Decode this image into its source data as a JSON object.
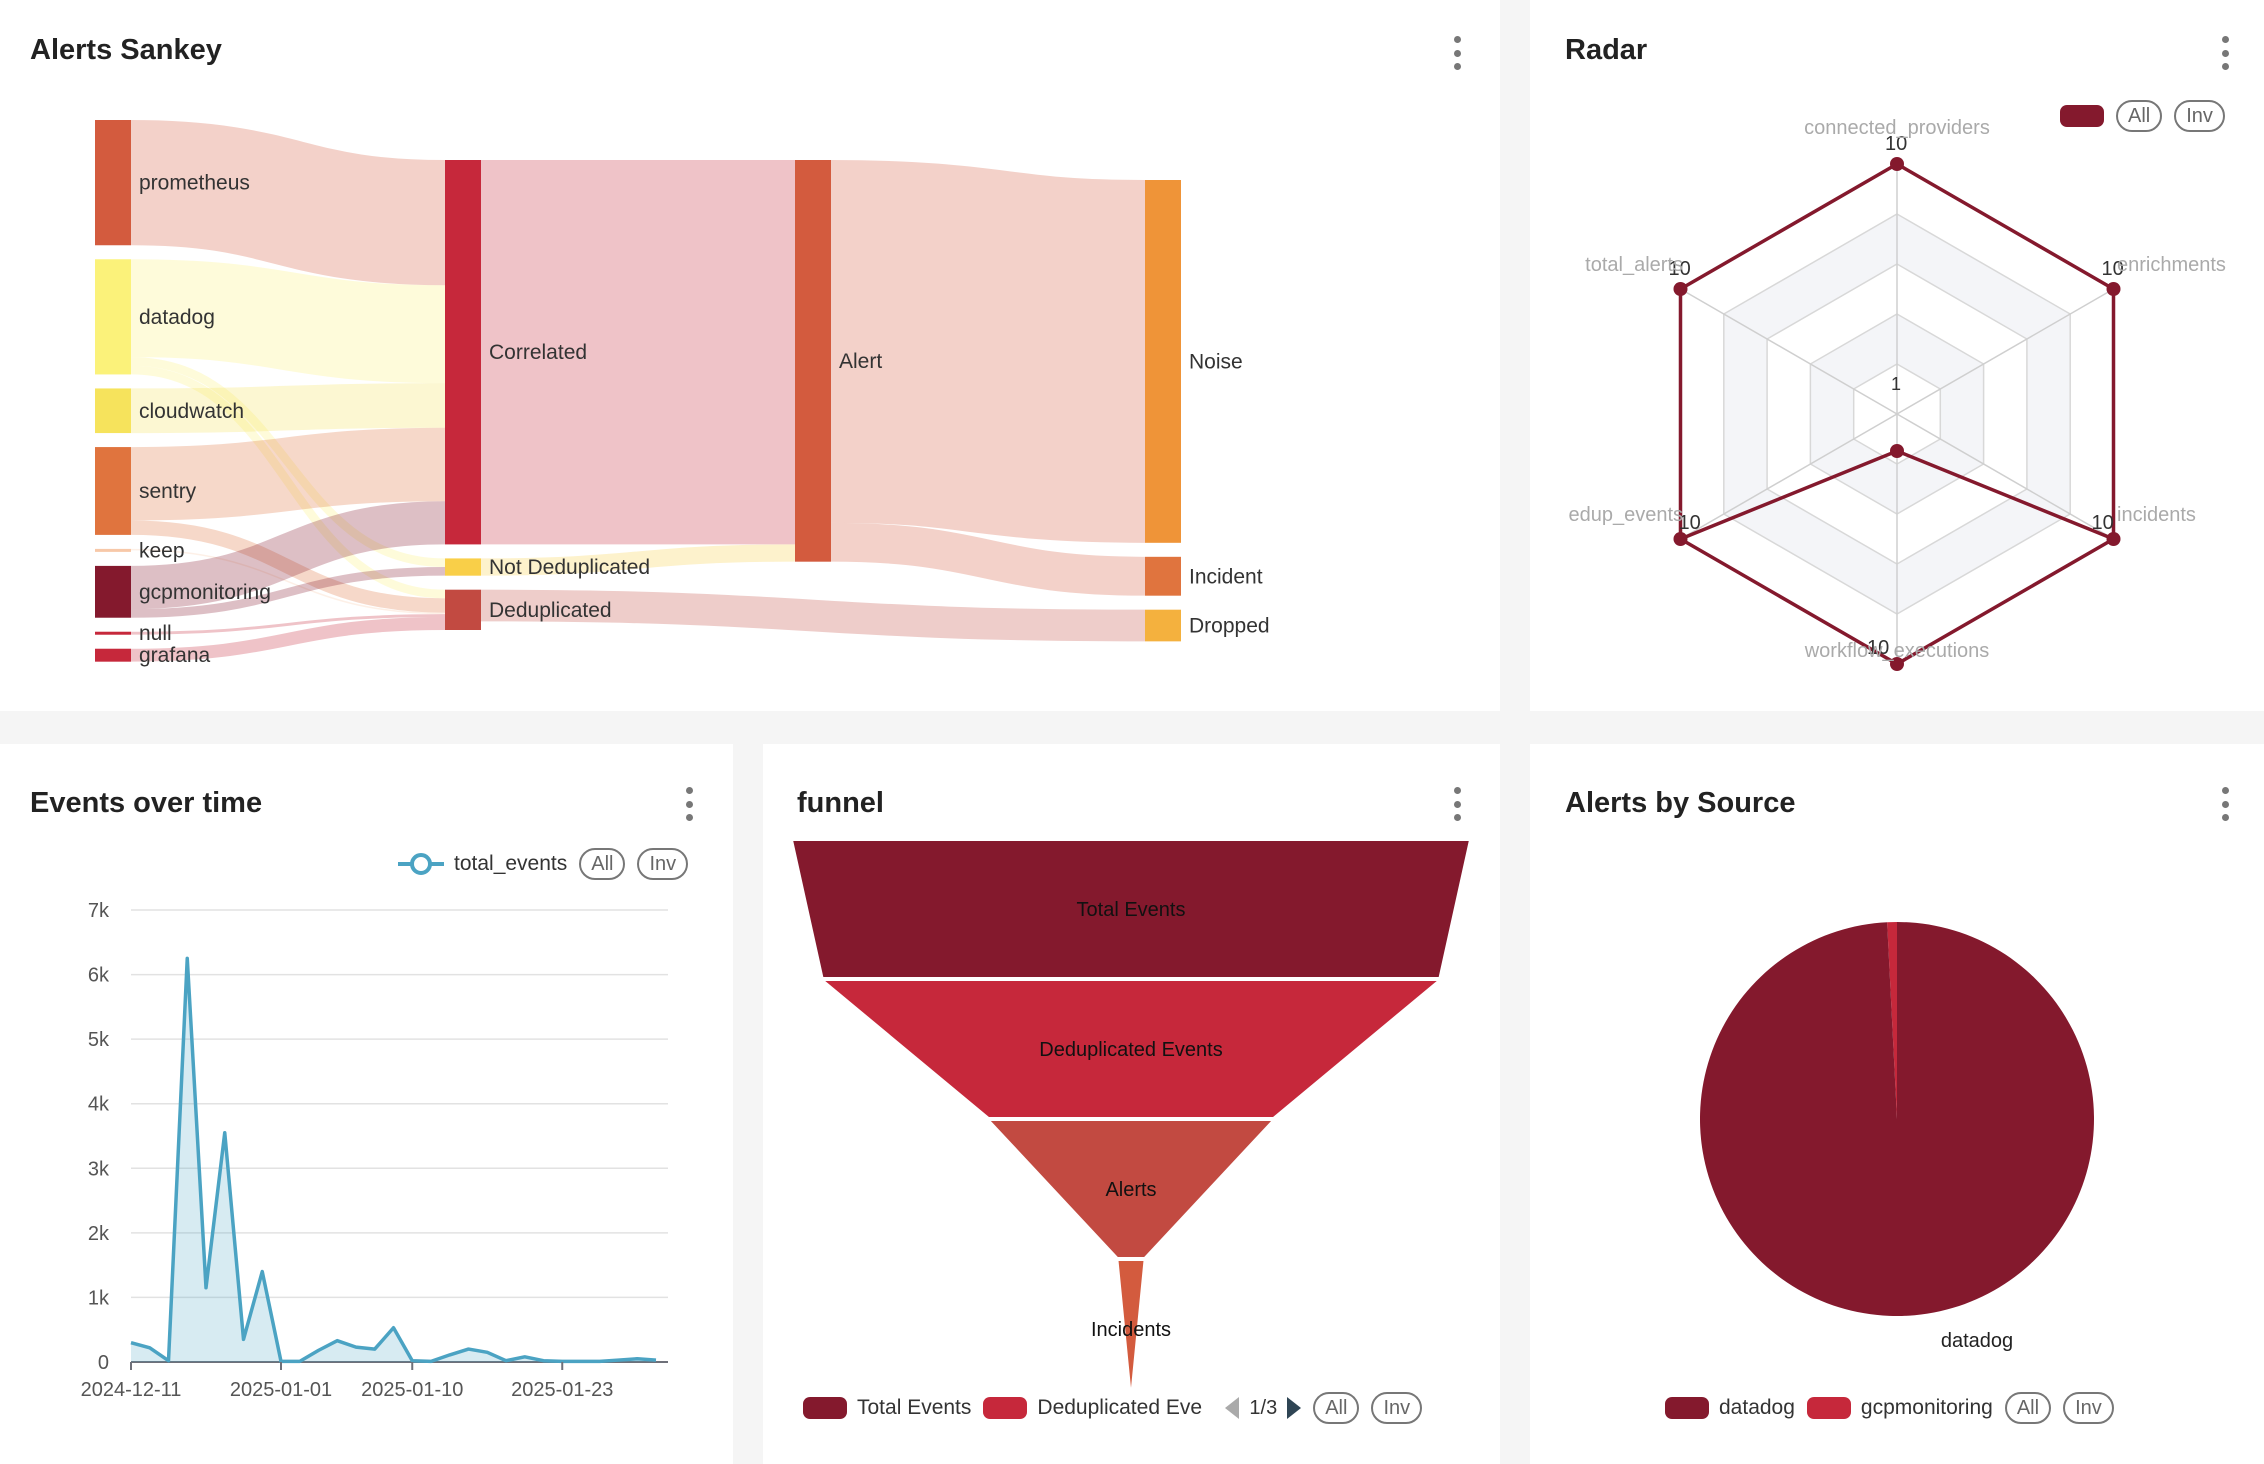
{
  "colors": {
    "maroon": "#84192d",
    "red": "#c6283b",
    "brick": "#c24a41",
    "orange_red": "#d35b3e",
    "orange": "#e0743e",
    "amber": "#ef9438",
    "gold": "#f4b13e",
    "yellow": "#f6e35c",
    "light_yellow": "#fbf27a",
    "line_blue": "#4ba3c3"
  },
  "menu_icon": "kebab-menu-icon",
  "sankey": {
    "title": "Alerts Sankey",
    "chart_data": {
      "type": "sankey",
      "nodes": [
        {
          "name": "prometheus",
          "column": 0
        },
        {
          "name": "datadog",
          "column": 0
        },
        {
          "name": "cloudwatch",
          "column": 0
        },
        {
          "name": "sentry",
          "column": 0
        },
        {
          "name": "keep",
          "column": 0
        },
        {
          "name": "gcpmonitoring",
          "column": 0
        },
        {
          "name": "null",
          "column": 0
        },
        {
          "name": "grafana",
          "column": 0
        },
        {
          "name": "Correlated",
          "column": 1
        },
        {
          "name": "Not Deduplicated",
          "column": 1
        },
        {
          "name": "Deduplicated",
          "column": 1
        },
        {
          "name": "Alert",
          "column": 2
        },
        {
          "name": "Noise",
          "column": 3
        },
        {
          "name": "Incident",
          "column": 3
        },
        {
          "name": "Dropped",
          "column": 3
        }
      ],
      "links": [
        {
          "source": "prometheus",
          "target": "Correlated",
          "value": 87
        },
        {
          "source": "datadog",
          "target": "Correlated",
          "value": 68
        },
        {
          "source": "datadog",
          "target": "Not Deduplicated",
          "value": 6
        },
        {
          "source": "datadog",
          "target": "Deduplicated",
          "value": 6
        },
        {
          "source": "cloudwatch",
          "target": "Correlated",
          "value": 31
        },
        {
          "source": "sentry",
          "target": "Correlated",
          "value": 51
        },
        {
          "source": "sentry",
          "target": "Deduplicated",
          "value": 10
        },
        {
          "source": "keep",
          "target": "Deduplicated",
          "value": 1
        },
        {
          "source": "gcpmonitoring",
          "target": "Correlated",
          "value": 30
        },
        {
          "source": "gcpmonitoring",
          "target": "Not Deduplicated",
          "value": 6
        },
        {
          "source": "null",
          "target": "Deduplicated",
          "value": 2
        },
        {
          "source": "grafana",
          "target": "Deduplicated",
          "value": 9
        },
        {
          "source": "Correlated",
          "target": "Alert",
          "value": 267
        },
        {
          "source": "Not Deduplicated",
          "target": "Alert",
          "value": 12
        },
        {
          "source": "Deduplicated",
          "target": "Dropped",
          "value": 22
        },
        {
          "source": "Alert",
          "target": "Noise",
          "value": 252
        },
        {
          "source": "Alert",
          "target": "Incident",
          "value": 27
        }
      ]
    }
  },
  "radar": {
    "title": "Radar",
    "legend": {
      "all": "All",
      "inv": "Inv"
    },
    "chart_data": {
      "type": "radar",
      "indicators": [
        "connected_providers",
        "enrichments",
        "incidents",
        "workflow_executions",
        "edup_events",
        "total_alerts"
      ],
      "max": 10,
      "min": 1,
      "series": [
        {
          "values": [
            10,
            10,
            10,
            10,
            10,
            10,
            1
          ]
        }
      ],
      "center_label": "1",
      "value_labels": [
        "10",
        "10",
        "10",
        "10",
        "10",
        "10"
      ],
      "inner_point_value": 1
    }
  },
  "events": {
    "title": "Events over time",
    "legend": {
      "series": "total_events",
      "all": "All",
      "inv": "Inv"
    },
    "chart_data": {
      "type": "area",
      "series": [
        {
          "name": "total_events",
          "values": [
            300,
            220,
            20,
            6250,
            1150,
            3550,
            350,
            1400,
            10,
            10,
            180,
            330,
            230,
            200,
            530,
            20,
            10,
            110,
            200,
            150,
            20,
            80,
            20,
            10,
            10,
            10,
            30,
            50,
            30
          ]
        }
      ],
      "x_ticks": [
        "2024-12-11",
        "2025-01-01",
        "2025-01-10",
        "2025-01-23"
      ],
      "y_ticks": [
        "0",
        "1k",
        "2k",
        "3k",
        "4k",
        "5k",
        "6k",
        "7k"
      ],
      "ylim": [
        0,
        7000
      ],
      "grid": true,
      "legend_position": "top-right"
    }
  },
  "funnel": {
    "title": "funnel",
    "legend": {
      "items": [
        "Total Events",
        "Deduplicated Events"
      ],
      "page": "1/3",
      "all": "All",
      "inv": "Inv"
    },
    "chart_data": {
      "type": "funnel",
      "stages": [
        "Total Events",
        "Deduplicated Events",
        "Alerts",
        "Incidents"
      ],
      "relative_widths": [
        100,
        91,
        42,
        4
      ]
    }
  },
  "source_pie": {
    "title": "Alerts by Source",
    "legend": {
      "items": [
        "datadog",
        "gcpmonitoring"
      ],
      "all": "All",
      "inv": "Inv"
    },
    "chart_data": {
      "type": "pie",
      "slices": [
        {
          "label": "datadog",
          "percent": 99.2
        },
        {
          "label": "gcpmonitoring",
          "percent": 0.8
        }
      ],
      "slice_label": "datadog"
    }
  }
}
